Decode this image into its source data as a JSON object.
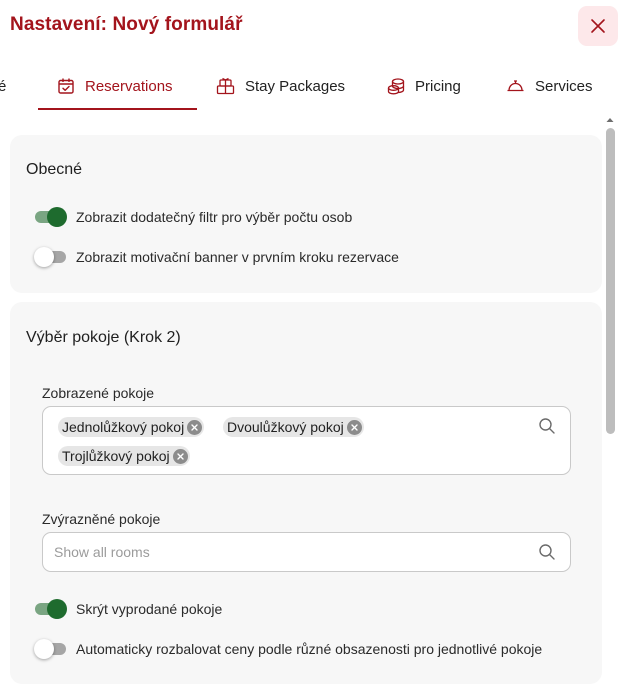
{
  "header": {
    "title": "Nastavení: Nový formulář"
  },
  "tabs": {
    "partial_label": "é",
    "items": [
      {
        "label": "Reservations",
        "icon": "calendar-check-icon",
        "active": true
      },
      {
        "label": "Stay Packages",
        "icon": "gift-boxes-icon",
        "active": false
      },
      {
        "label": "Pricing",
        "icon": "coins-icon",
        "active": false
      },
      {
        "label": "Services",
        "icon": "service-bell-icon",
        "active": false
      }
    ]
  },
  "general": {
    "title": "Obecné",
    "toggles": [
      {
        "label": "Zobrazit dodatečný filtr pro výběr počtu osob",
        "checked": true
      },
      {
        "label": "Zobrazit motivační banner v prvním kroku rezervace",
        "checked": false
      }
    ]
  },
  "room_selection": {
    "title": "Výběr pokoje (Krok 2)",
    "displayed_rooms": {
      "label": "Zobrazené pokoje",
      "chips": [
        "Jednolůžkový pokoj",
        "Dvoulůžkový pokoj",
        "Trojlůžkový pokoj"
      ]
    },
    "highlighted_rooms": {
      "label": "Zvýrazněné pokoje",
      "placeholder": "Show all rooms"
    },
    "toggles": [
      {
        "label": "Skrýt vyprodané pokoje",
        "checked": true
      },
      {
        "label": "Automaticky rozbalovat ceny podle různé obsazenosti pro jednotlivé pokoje",
        "checked": false
      }
    ]
  },
  "colors": {
    "accent": "#a3141c",
    "toggle_on": "#1e6b2e",
    "card_bg": "#f7f7f7"
  }
}
